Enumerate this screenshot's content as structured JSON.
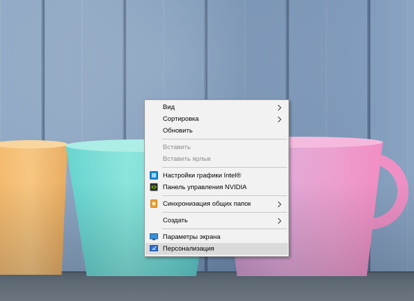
{
  "desktop": {
    "wallpaper": "wooden-wall-with-cups",
    "colors": {
      "cup_yellow": "#f3b86a",
      "cup_teal": "#6dd8d2",
      "cup_pink": "#ec9fce"
    }
  },
  "context_menu": {
    "items": [
      {
        "label": "Вид",
        "has_submenu": true,
        "enabled": true
      },
      {
        "label": "Сортировка",
        "has_submenu": true,
        "enabled": true
      },
      {
        "label": "Обновить",
        "has_submenu": false,
        "enabled": true
      },
      {
        "label": "Вставить",
        "has_submenu": false,
        "enabled": false
      },
      {
        "label": "Вставить ярлык",
        "has_submenu": false,
        "enabled": false
      },
      {
        "label": "Настройки графики Intel®",
        "icon": "intel-graphics-icon",
        "enabled": true
      },
      {
        "label": "Панель управления NVIDIA",
        "icon": "nvidia-icon",
        "enabled": true
      },
      {
        "label": "Синхронизация общих папок",
        "icon": "sync-folders-icon",
        "has_submenu": true,
        "enabled": true
      },
      {
        "label": "Создать",
        "has_submenu": true,
        "enabled": true
      },
      {
        "label": "Параметры экрана",
        "icon": "display-settings-icon",
        "enabled": true
      },
      {
        "label": "Персонализация",
        "icon": "personalization-icon",
        "enabled": true,
        "highlighted": true
      }
    ],
    "colors": {
      "background": "#f2f2f2",
      "highlight": "#dadada",
      "disabled_text": "#8d8d8d"
    }
  }
}
